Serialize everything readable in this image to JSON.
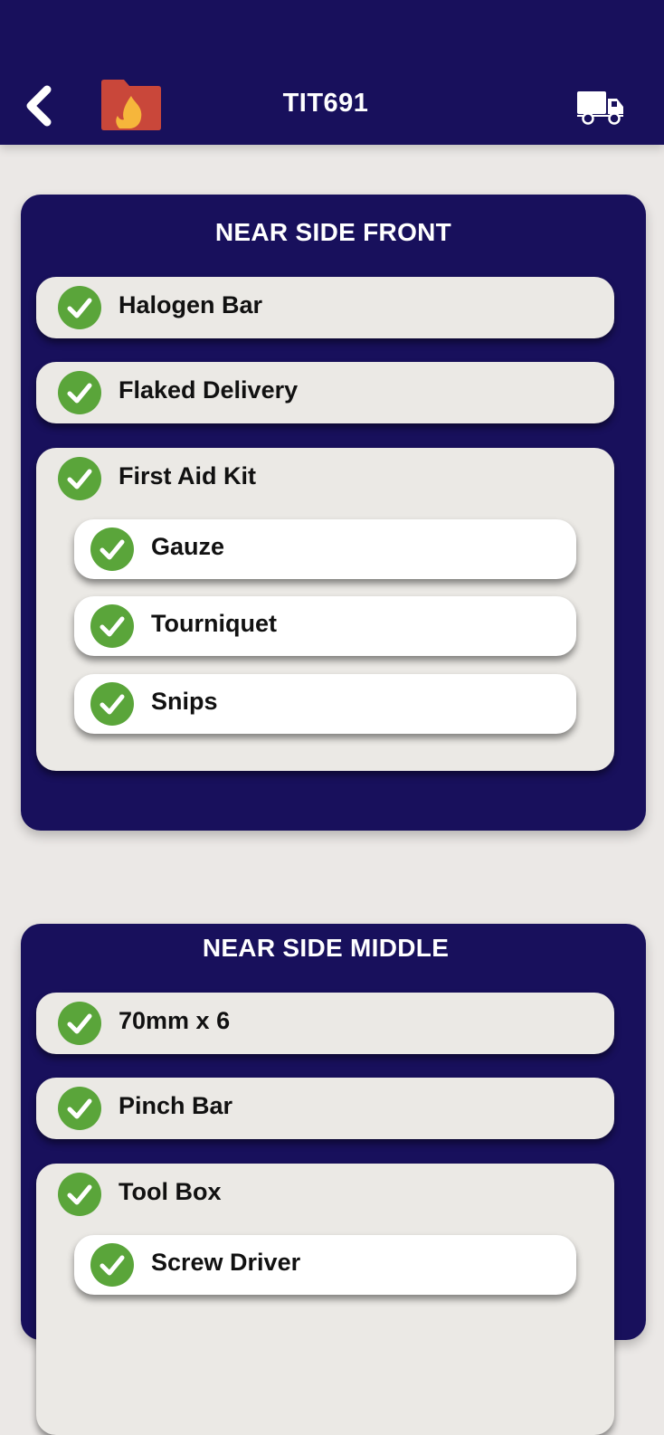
{
  "header": {
    "title": "TIT691",
    "back_icon": "chevron-left-icon",
    "folder_icon": "fire-folder-icon",
    "truck_icon": "truck-icon"
  },
  "colors": {
    "navy": "#18105c",
    "background": "#ebe8e6",
    "check_green": "#5aa53a",
    "folder_red": "#c9473a",
    "flame_yellow": "#f6b63b"
  },
  "sections": [
    {
      "title": "NEAR SIDE FRONT",
      "items": [
        {
          "label": "Halogen Bar"
        },
        {
          "label": "Flaked Delivery"
        },
        {
          "label": "First Aid Kit",
          "children": [
            {
              "label": "Gauze"
            },
            {
              "label": "Tourniquet"
            },
            {
              "label": "Snips"
            }
          ]
        }
      ]
    },
    {
      "title": "NEAR SIDE MIDDLE",
      "items": [
        {
          "label": "70mm x 6"
        },
        {
          "label": "Pinch Bar"
        },
        {
          "label": "Tool Box",
          "children": [
            {
              "label": "Screw Driver"
            }
          ]
        }
      ]
    }
  ]
}
